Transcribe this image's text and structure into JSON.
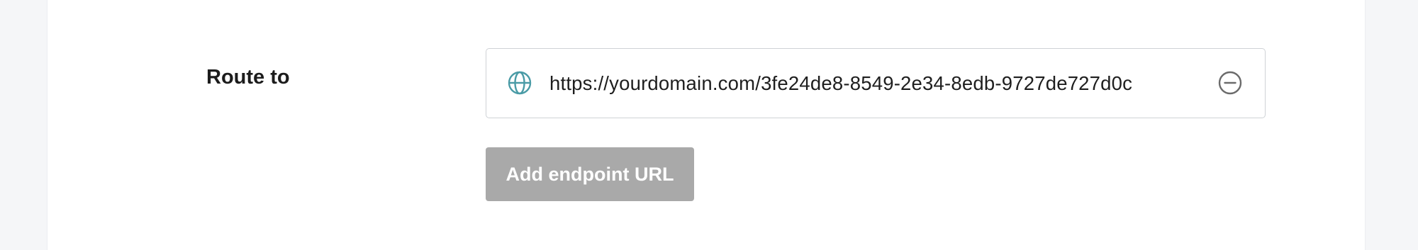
{
  "routing": {
    "label": "Route to",
    "endpoints": [
      {
        "url": "https://yourdomain.com/3fe24de8-8549-2e34-8edb-9727de727d0c",
        "icon": "globe-icon",
        "remove_icon": "minus-circle-icon"
      }
    ],
    "add_button_label": "Add endpoint URL"
  },
  "colors": {
    "globe_icon": "#4a9ba6",
    "remove_icon": "#6b6b6b",
    "add_button_bg": "#a9a9a9",
    "add_button_text": "#ffffff"
  }
}
